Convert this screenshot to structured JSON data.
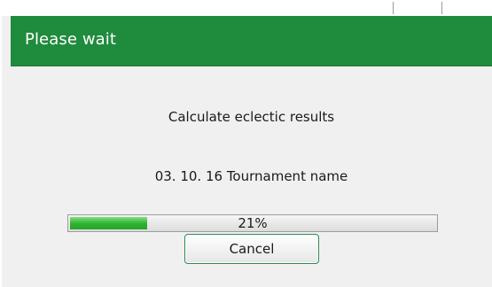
{
  "dialog": {
    "title": "Please wait",
    "message": "Calculate eclectic results",
    "tournament_line": "03. 10. 16 Tournament name",
    "progress": {
      "percent": 21,
      "label": "21%"
    },
    "cancel_label": "Cancel"
  },
  "colors": {
    "titlebar": "#1f8b3d",
    "progress_fill": "#2fb12f",
    "button_border": "#2e8b57"
  }
}
